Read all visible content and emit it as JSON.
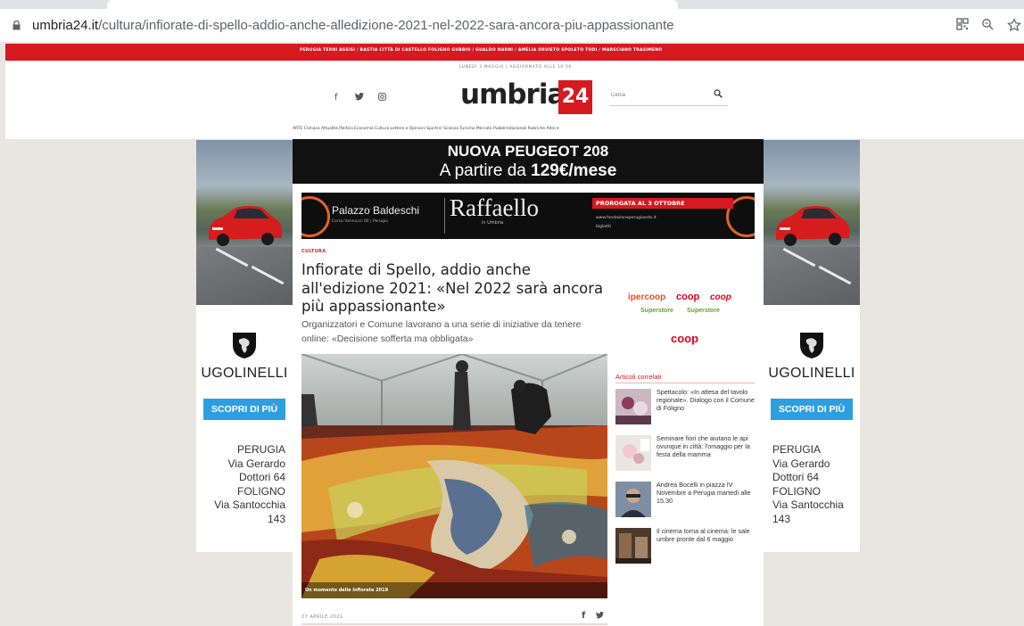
{
  "browser": {
    "url_host": "umbria24.it",
    "url_path": "/cultura/infiorate-di-spello-addio-anche-alledizione-2021-nel-2022-sara-ancora-piu-appassionante",
    "icons": [
      "qr-code-icon",
      "zoom-icon",
      "bookmark-star-icon"
    ]
  },
  "site": {
    "dateline": "LUNEDÌ 3 MAGGIO | AGGIORNATO ALLE 10:50",
    "logo_text": "umbria",
    "logo_number": "24",
    "search_placeholder": "Cerca",
    "city_nav": "PERUGIA  TERNI  ASSISI / BASTIA  CITTÀ DI CASTELLO  FOLIGNO  GUBBIO / GUALDO  NARNI / AMELIA  ORVIETO  SPOLETO  TODI / MARSCIANO  TRASIMENO",
    "section_nav": "ARTE  Cronaca  Attualità  Politica  Economia  Cultura  Lettere e Opinioni  Sport(s)  Scienza  Turismo  Mercato  Pubbliredazionali  Rubriche  Altro ▾",
    "social_icons": [
      "facebook-icon",
      "twitter-icon",
      "instagram-icon"
    ]
  },
  "ads": {
    "top_banner_line1": "NUOVA PEUGEOT 208",
    "top_banner_line2_prefix": "A partire da ",
    "top_banner_line2_price": "129€/mese",
    "side_brand": "UGOLINELLI",
    "side_cta": "SCOPRI DI PIÙ",
    "side_left_address": [
      "PERUGIA",
      "Via Gerardo",
      "Dottori 64",
      "FOLIGNO",
      "Via Santocchia",
      "143"
    ],
    "side_right_address": [
      "PERUGIA",
      "Via Gerardo",
      "Dottori 64",
      "FOLIGNO",
      "Via Santocchia",
      "143"
    ],
    "raffaello": {
      "venue": "Palazzo Baldeschi",
      "venue_address": "Corso Vannucci 66 | Perugia",
      "title": "Raffaello",
      "subtitle": "in Umbria",
      "prorogata": "PROROGATA AL 3 OTTOBRE",
      "website": "www.fondazioneperugiaarte.it",
      "tickets": "biglietti"
    }
  },
  "article": {
    "category": "CULTURA",
    "headline": "Infiorate di Spello, addio anche all'edizione 2021: «Nel 2022 sarà ancora più appassionante»",
    "summary": "Organizzatori e Comune lavorano a una serie di iniziative da tenere online: «Decisione sofferta ma obbligata»",
    "photo_caption": "Un momento delle Infiorate 2019",
    "date": "27 APRILE 2021",
    "share_icons": [
      "facebook-share-icon",
      "twitter-share-icon"
    ]
  },
  "sidebar": {
    "coop_logos": [
      "ipercoop",
      "coop",
      "coop",
      "Superstore",
      "Superstore",
      "coop"
    ],
    "related_title": "Articoli correlati",
    "related": [
      {
        "text": "Spettacolo: «In attesa del tavolo regionale». Dialogo con il Comune di Foligno"
      },
      {
        "text": "Seminare fiori che aiutano le api ovunque in città: l'omaggio per la festa della mamma"
      },
      {
        "text": "Andrea Bocelli in piazza IV Novembre a Perugia martedì alle 15.30"
      },
      {
        "text": "Il cinema torna al cinema: le sale umbre pronte dal 6 maggio"
      }
    ]
  },
  "colors": {
    "brand_red": "#d71920",
    "cta_blue": "#2d9fe0",
    "page_bg": "#e9e5e0"
  }
}
